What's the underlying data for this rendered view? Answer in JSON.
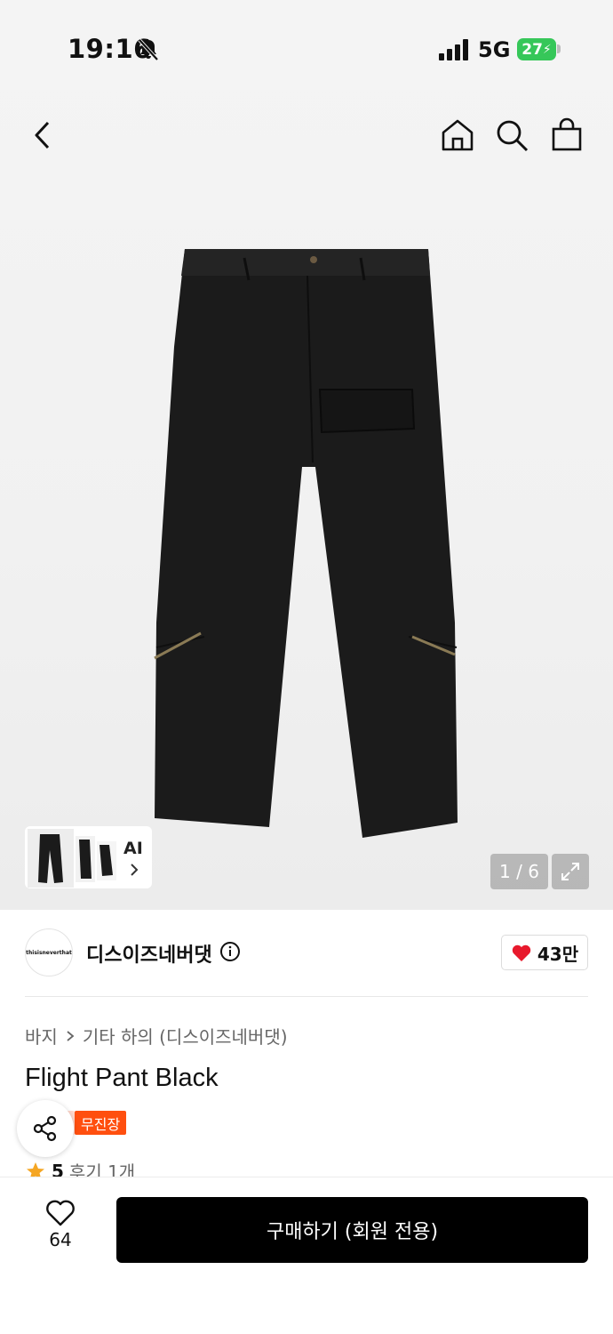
{
  "status_bar": {
    "time": "19:16",
    "network": "5G",
    "battery": "27"
  },
  "nav": {
    "icons": [
      "back-icon",
      "home-icon",
      "search-icon",
      "bag-icon"
    ]
  },
  "gallery": {
    "ai_label": "AI",
    "counter": "1 / 6"
  },
  "brand": {
    "name": "디스이즈네버댓",
    "logo_text": "thisisneverthat",
    "likes": "43만"
  },
  "breadcrumb": {
    "category": "바지",
    "subcategory": "기타 하의 (디스이즈네버댓)"
  },
  "product": {
    "title": "Flight Pant Black",
    "tag": "무진장",
    "rating": "5",
    "reviews": "후기 1개"
  },
  "bottom_bar": {
    "wish_count": "64",
    "buy_label": "구매하기 (회원 전용)"
  },
  "colors": {
    "accent": "#ff4f0f",
    "heart": "#e8192c",
    "star": "#f5a623",
    "button": "#000000"
  }
}
